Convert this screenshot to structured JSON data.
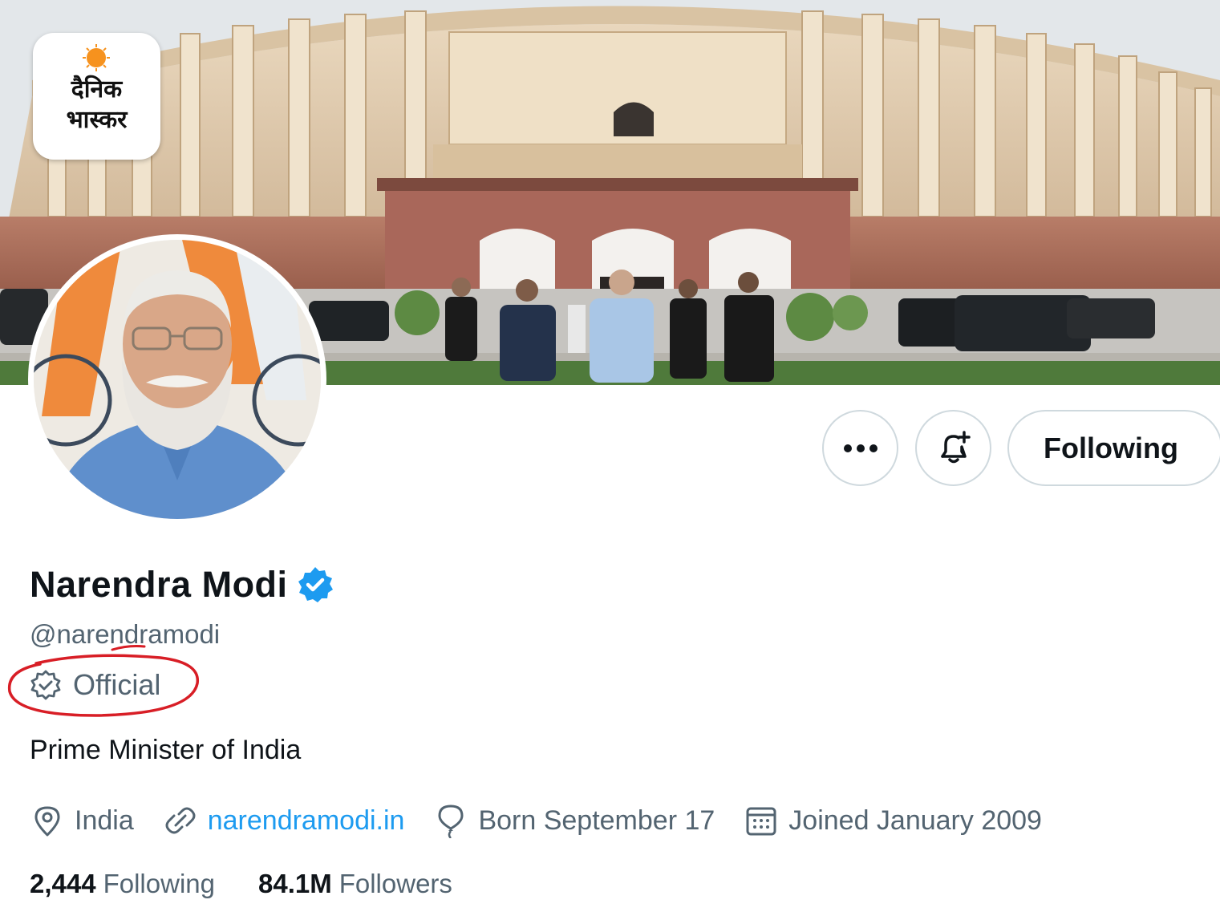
{
  "logo": {
    "line1": "दैनिक",
    "line2": "भास्कर"
  },
  "actions": {
    "more_icon": "more-horizontal-icon",
    "notify_icon": "notification-bell-plus-icon",
    "follow_label": "Following"
  },
  "profile": {
    "display_name": "Narendra Modi",
    "verified_icon": "verified-badge-icon",
    "verified_color": "#1d9bf0",
    "handle": "@narendramodi",
    "official_label": "Official",
    "bio": "Prime Minister of India",
    "meta": {
      "location": "India",
      "website": "narendramodi.in",
      "birthday": "Born September 17",
      "joined": "Joined January 2009"
    },
    "stats": {
      "following_count": "2,444",
      "following_label": "Following",
      "followers_count": "84.1M",
      "followers_label": "Followers"
    }
  },
  "colors": {
    "link": "#1d9bf0",
    "secondary_text": "#536471",
    "annotation": "#d81e26"
  }
}
